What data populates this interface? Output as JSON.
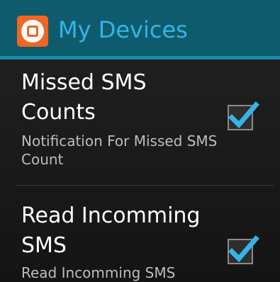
{
  "action_bar": {
    "title": "My Devices",
    "app_icon": "app-logo-icon",
    "accent_color": "#33b5e5"
  },
  "preferences": [
    {
      "title": "Missed SMS Counts",
      "summary": "Notification For Missed SMS Count",
      "checked": true
    },
    {
      "title": "Read Incomming SMS",
      "summary": "Read Incomming SMS",
      "checked": true
    }
  ],
  "icons": {
    "checkmark": "checkmark-icon"
  }
}
